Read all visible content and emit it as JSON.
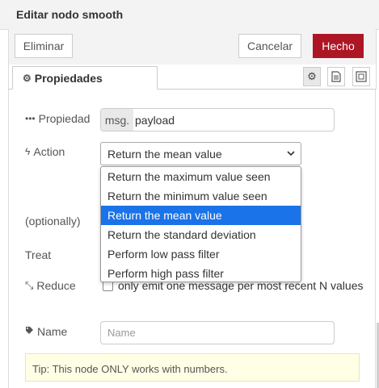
{
  "header": {
    "title": "Editar nodo smooth"
  },
  "toolbar": {
    "delete_label": "Eliminar",
    "cancel_label": "Cancelar",
    "done_label": "Hecho",
    "done_color": "#ad1625"
  },
  "tabs": {
    "properties_label": "Propiedades"
  },
  "form": {
    "property": {
      "label": "Propiedad",
      "prefix": "msg.",
      "value": "payload"
    },
    "action": {
      "label": "Action",
      "selected": "Return the mean value",
      "options": [
        "Return the maximum value seen",
        "Return the minimum value seen",
        "Return the mean value",
        "Return the standard deviation",
        "Perform low pass filter",
        "Perform high pass filter"
      ],
      "highlight_color": "#1a73e8"
    },
    "optionally_label": "(optionally)",
    "treat_label": "Treat",
    "reduce": {
      "label": "Reduce",
      "checkbox_text": "only emit one message per most recent N values",
      "checked": false
    },
    "name": {
      "label": "Name",
      "placeholder": "Name",
      "value": ""
    }
  },
  "tip": "Tip: This node ONLY works with numbers."
}
